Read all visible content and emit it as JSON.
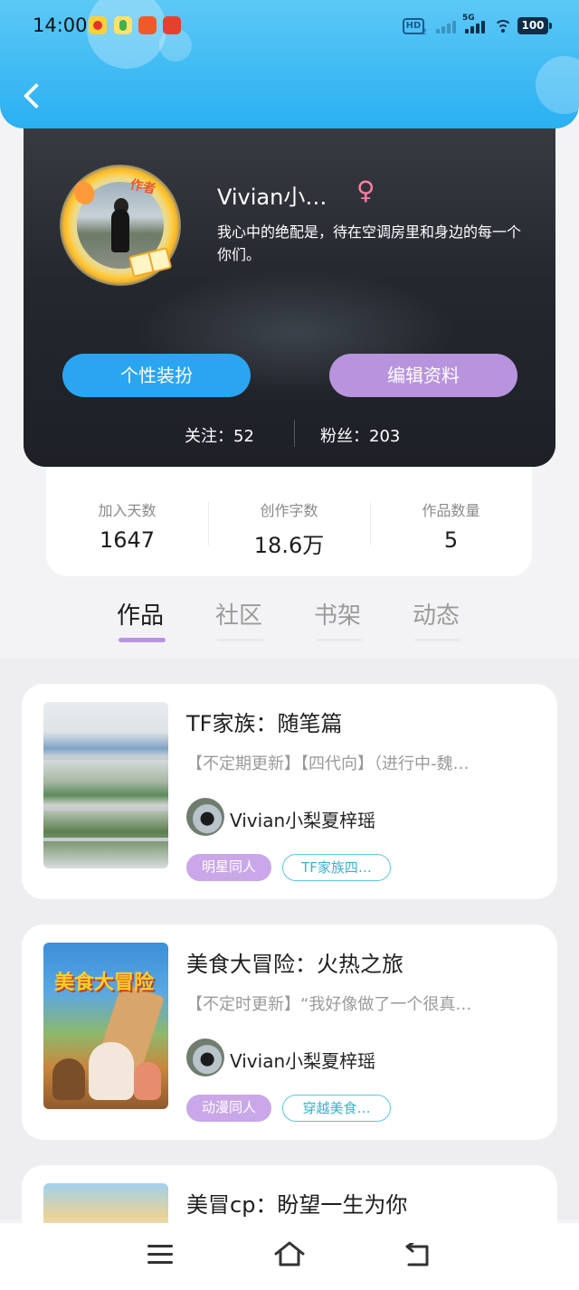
{
  "status_bar": {
    "time": "14:00",
    "hd_label": "HD",
    "hd_sub": "2",
    "network_label": "5G",
    "battery": "100"
  },
  "header": {
    "back_icon": "chevron-left-icon"
  },
  "profile": {
    "username": "Vivian小…",
    "gender_symbol": "♀",
    "author_badge": "作者",
    "bio": "我心中的绝配是，待在空调房里和身边的每一个你们。",
    "buttons": {
      "dress_up": "个性装扮",
      "edit_profile": "编辑资料"
    },
    "following": "关注：52",
    "fans": "粉丝：203"
  },
  "stats": [
    {
      "label": "加入天数",
      "value": "1647"
    },
    {
      "label": "创作字数",
      "value": "18.6万"
    },
    {
      "label": "作品数量",
      "value": "5"
    }
  ],
  "tabs": [
    {
      "label": "作品",
      "active": true
    },
    {
      "label": "社区",
      "active": false
    },
    {
      "label": "书架",
      "active": false
    },
    {
      "label": "动态",
      "active": false
    }
  ],
  "works": [
    {
      "title": "TF家族：随笔篇",
      "desc": "【不定期更新】【四代向】（进行中-魏…",
      "author": "Vivian小梨夏梓瑶",
      "tags": [
        "明星同人",
        "TF家族四…"
      ]
    },
    {
      "title": "美食大冒险：火热之旅",
      "desc": "【不定时更新】“我好像做了一个很真…",
      "author": "Vivian小梨夏梓瑶",
      "tags": [
        "动漫同人",
        "穿越美食…"
      ]
    },
    {
      "title": "美冒cp：盼望一生为你"
    }
  ],
  "colors": {
    "header_blue": "#2ab0f2",
    "accent_purple": "#b894df",
    "button_blue": "#2aa5f2",
    "gender_pink": "#ff7ea7",
    "tag_cyan": "#39b1cf"
  },
  "navbar": {
    "menu_icon": "menu-icon",
    "home_icon": "home-icon",
    "back_icon": "back-icon"
  }
}
